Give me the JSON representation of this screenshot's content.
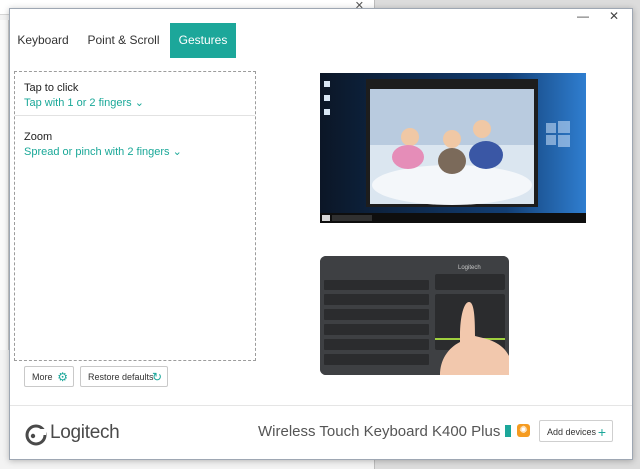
{
  "window": {
    "minimize_glyph": "—",
    "close_glyph": "✕"
  },
  "tabs": [
    {
      "label": "Keyboard",
      "active": false
    },
    {
      "label": "Point & Scroll",
      "active": false
    },
    {
      "label": "Gestures",
      "active": true
    }
  ],
  "gestures": [
    {
      "name": "Tap to click",
      "value": "Tap with 1 or 2 fingers"
    },
    {
      "name": "Zoom",
      "value": "Spread or pinch with 2 fingers"
    }
  ],
  "buttons": {
    "more": "More",
    "restore": "Restore defaults",
    "add_devices": "Add devices"
  },
  "footer": {
    "brand": "Logitech",
    "device_name": "Wireless Touch Keyboard K400 Plus"
  },
  "colors": {
    "accent": "#1ca79a",
    "battery": "#1ca79a",
    "unifying": "#f59b20"
  },
  "icons": {
    "more": "gear-icon",
    "restore": "refresh-icon",
    "add": "plus-icon",
    "battery": "battery-icon",
    "receiver": "unifying-receiver-icon",
    "brand": "logitech-logo-icon"
  }
}
